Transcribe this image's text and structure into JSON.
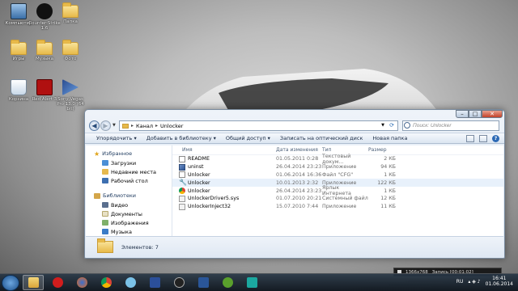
{
  "desktop": {
    "icons": [
      {
        "label": "Компьютер",
        "kind": "computer"
      },
      {
        "label": "Counter-Strike 1.6",
        "kind": "app"
      },
      {
        "label": "Папка",
        "kind": "folder"
      },
      {
        "label": "Игры",
        "kind": "folder"
      },
      {
        "label": "Музыка",
        "kind": "folder"
      },
      {
        "label": "Фото",
        "kind": "folder"
      },
      {
        "label": "Корзина",
        "kind": "recycle-bin"
      },
      {
        "label": "Red Alert 3",
        "kind": "app"
      },
      {
        "label": "Sony Vegas Pro 13.0 (64 bit)",
        "kind": "app"
      }
    ]
  },
  "window": {
    "address": {
      "crumbs": [
        "Канал",
        "Unlocker"
      ],
      "search_placeholder": "Поиск: Unlocker"
    },
    "toolbar": {
      "items": [
        "Упорядочить ▾",
        "Добавить в библиотеку ▾",
        "Общий доступ ▾",
        "Записать на оптический диск",
        "Новая папка"
      ]
    },
    "nav": {
      "favorites_label": "Избранное",
      "favorites": [
        "Загрузки",
        "Недавние места",
        "Рабочий стол"
      ],
      "libraries_label": "Библиотеки",
      "libraries": [
        "Видео",
        "Документы",
        "Изображения",
        "Музыка"
      ]
    },
    "columns": {
      "name": "Имя",
      "date": "Дата изменения",
      "type": "Тип",
      "size": "Размер"
    },
    "files": [
      {
        "name": "README",
        "date": "01.05.2011 0:28",
        "type": "Текстовый докум...",
        "size": "2 КБ",
        "icon": "doc"
      },
      {
        "name": "uninst",
        "date": "26.04.2014 23:23",
        "type": "Приложение",
        "size": "94 КБ",
        "icon": "app"
      },
      {
        "name": "Unlocker",
        "date": "01.06.2014 16:36",
        "type": "Файл \"CFG\"",
        "size": "1 КБ",
        "icon": "doc"
      },
      {
        "name": "Unlocker",
        "date": "10.01.2013 2:32",
        "type": "Приложение",
        "size": "122 КБ",
        "icon": "wrench"
      },
      {
        "name": "Unlocker",
        "date": "26.04.2014 23:23",
        "type": "Ярлык Интернета",
        "size": "1 КБ",
        "icon": "url"
      },
      {
        "name": "UnlockerDriver5.sys",
        "date": "01.07.2010 20:21",
        "type": "Системный файл",
        "size": "12 КБ",
        "icon": "sys"
      },
      {
        "name": "UnlockerInject32",
        "date": "15.07.2010 7:44",
        "type": "Приложение",
        "size": "11 КБ",
        "icon": "app"
      }
    ],
    "status": "Элементов: 7"
  },
  "recording": {
    "resolution": "1366x768",
    "label": "Запись [00:01:02]"
  },
  "taskbar": {
    "apps": [
      "Проводник",
      "Opera",
      "Firefox",
      "Chrome",
      "Lupa",
      "Сохранить",
      "Media",
      "Word",
      "uTorrent",
      "Camtasia"
    ],
    "lang": "RU",
    "time": "16:41",
    "date": "01.06.2014"
  }
}
